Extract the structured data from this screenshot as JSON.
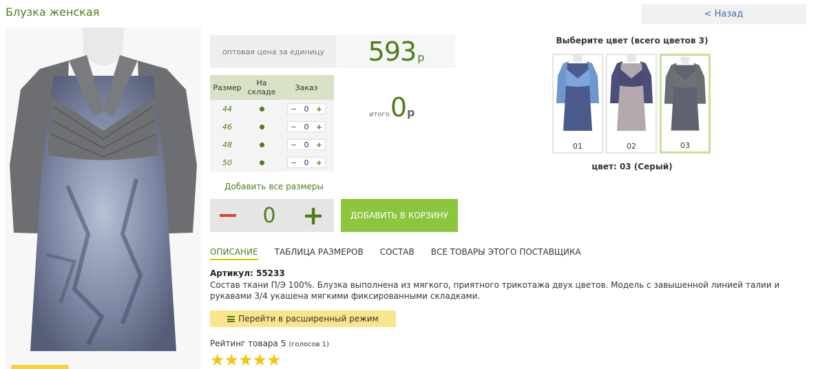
{
  "product": {
    "title": "Блузка женская",
    "back_label": "Назад",
    "back_glyph": "<"
  },
  "price": {
    "label": "оптовая цена за единицу",
    "value": "593",
    "currency": "р"
  },
  "sizes": {
    "headers": [
      "Размер",
      "На складе",
      "Заказ"
    ],
    "rows": [
      {
        "size": "44",
        "in_stock": true,
        "qty": "0"
      },
      {
        "size": "46",
        "in_stock": true,
        "qty": "0"
      },
      {
        "size": "48",
        "in_stock": true,
        "qty": "0"
      },
      {
        "size": "50",
        "in_stock": true,
        "qty": "0"
      }
    ],
    "minus": "−",
    "plus": "+"
  },
  "total": {
    "label": "итого",
    "value": "0",
    "currency": "р"
  },
  "add_all_label": "Добавить все размеры",
  "quantity": {
    "value": "0",
    "plus": "+"
  },
  "add_to_cart_label": "ДОБАВИТЬ В КОРЗИНУ",
  "colors": {
    "title": "Выберите цвет (всего цветов 3)",
    "items": [
      {
        "num": "01",
        "accent": "#6f97cf"
      },
      {
        "num": "02",
        "accent": "#4d4e7a"
      },
      {
        "num": "03",
        "accent": "#6b6d70"
      }
    ],
    "selected_index": 2,
    "current_label": "цвет: 03 (Серый)"
  },
  "tabs": [
    {
      "label": "ОПИСАНИЕ",
      "active": true
    },
    {
      "label": "ТАБЛИЦА РАЗМЕРОВ",
      "active": false
    },
    {
      "label": "СОСТАВ",
      "active": false
    },
    {
      "label": "ВСЕ ТОВАРЫ ЭТОГО ПОСТАВЩИКА",
      "active": false
    }
  ],
  "description": {
    "sku": "Артикул: 55233",
    "text": "Состав ткани П/Э 100%. Блузка выполнена из мягкого, приятного трикотажа двух цветов. Модель с завышенной линией талии и рукавами 3/4 укашена мягкими фиксированными складками."
  },
  "advanced_mode_label": "Перейти в расширенный режим",
  "rating": {
    "label": "Рейтинг товара 5",
    "votes": "(голосов 1)",
    "value": 5,
    "max": 5
  },
  "theme": {
    "green": "#4e7d1a",
    "cart_green": "#8cc63e",
    "star": "#f1c40f",
    "minus_red": "#e04037"
  }
}
